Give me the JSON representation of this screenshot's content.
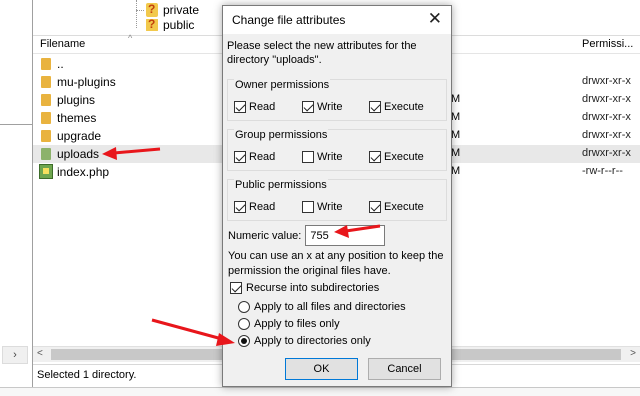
{
  "tree": {
    "items": [
      "private",
      "public"
    ]
  },
  "file_list": {
    "headers": {
      "name": "Filename",
      "permissions": "Permissi..."
    },
    "rows": [
      {
        "name": "..",
        "perm": "",
        "icon": "folder-icon"
      },
      {
        "name": "mu-plugins",
        "perm": "drwxr-xr-x",
        "icon": "folder-icon"
      },
      {
        "name": "plugins",
        "perm": "drwxr-xr-x",
        "icon": "folder-icon"
      },
      {
        "name": "themes",
        "perm": "drwxr-xr-x",
        "icon": "folder-icon"
      },
      {
        "name": "upgrade",
        "perm": "drwxr-xr-x",
        "icon": "folder-icon"
      },
      {
        "name": "uploads",
        "perm": "drwxr-xr-x",
        "icon": "folder-icon",
        "selected": true
      },
      {
        "name": "index.php",
        "perm": "-rw-r--r--",
        "icon": "php-file-icon"
      }
    ],
    "partial_col_letter": "M"
  },
  "status": {
    "text": "Selected 1 directory."
  },
  "dialog": {
    "title": "Change file attributes",
    "close_icon": "close-icon",
    "intro": "Please select the new attributes for the directory \"uploads\".",
    "groups": [
      {
        "title": "Owner permissions",
        "read": true,
        "write": true,
        "execute": true
      },
      {
        "title": "Group permissions",
        "read": true,
        "write": false,
        "execute": true
      },
      {
        "title": "Public permissions",
        "read": true,
        "write": false,
        "execute": true
      }
    ],
    "labels": {
      "read": "Read",
      "write": "Write",
      "execute": "Execute"
    },
    "numeric_label": "Numeric value:",
    "numeric_value": "755",
    "note": "You can use an x at any position to keep the permission the original files have.",
    "recurse_label": "Recurse into subdirectories",
    "recurse_checked": true,
    "radio_options": [
      {
        "label": "Apply to all files and directories",
        "selected": false
      },
      {
        "label": "Apply to files only",
        "selected": false
      },
      {
        "label": "Apply to directories only",
        "selected": true
      }
    ],
    "ok_label": "OK",
    "cancel_label": "Cancel"
  },
  "colors": {
    "arrow": "#e8161b",
    "selected_row": "#e8e8e8",
    "ok_border": "#0078d7"
  }
}
